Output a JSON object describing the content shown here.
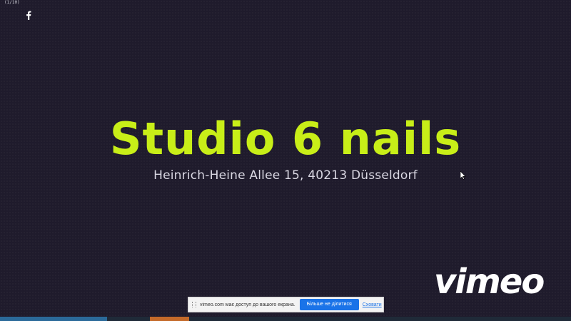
{
  "corner_tag": "(1/10)",
  "social": {
    "facebook_icon": "facebook-icon"
  },
  "hero": {
    "title": "Studio 6 nails",
    "address": "Heinrich-Heine Allee 15, 40213 Düsseldorf"
  },
  "player": {
    "brand": "vimeo"
  },
  "share_bar": {
    "message": "vimeo.com має доступ до вашого екрана.",
    "stop_label": "Більше не ділитися",
    "hide_label": "Сховати"
  },
  "colors": {
    "background": "#1f1b2c",
    "title": "#c8ee18",
    "address": "#d9d7e2",
    "share_button": "#1a73e8"
  }
}
